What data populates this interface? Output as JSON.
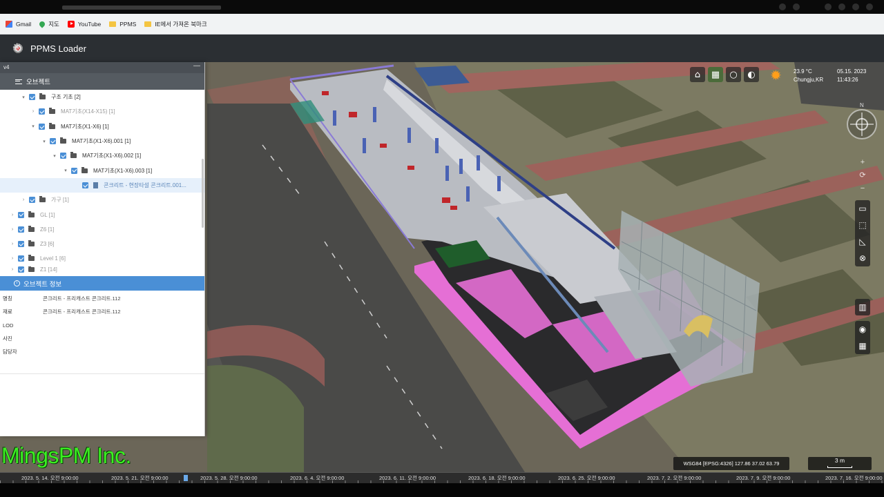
{
  "bookmarks": [
    {
      "label": "Gmail",
      "icon": "gmail-icon"
    },
    {
      "label": "지도",
      "icon": "maps-icon"
    },
    {
      "label": "YouTube",
      "icon": "youtube-icon"
    },
    {
      "label": "PPMS",
      "icon": "folder-icon"
    },
    {
      "label": "IE에서 가져온 북마크",
      "icon": "folder-icon"
    }
  ],
  "app": {
    "title": "PPMS Loader"
  },
  "panel": {
    "version": "v4",
    "tree_title": "오브젝트",
    "tree": [
      {
        "label": "구조 기초 [2]",
        "expander": "▾"
      },
      {
        "label": "MAT기초(X14-X15) [1]",
        "expander": "›"
      },
      {
        "label": "MAT기초(X1-X6) [1]",
        "expander": "▾"
      },
      {
        "label": "MAT기초(X1-X6).001 [1]",
        "expander": "▾"
      },
      {
        "label": "MAT기초(X1-X6).002 [1]",
        "expander": "▾"
      },
      {
        "label": "MAT기초(X1-X6).003 [1]",
        "expander": "▾"
      },
      {
        "label": "콘크리트 - 현장타설 콘크리트.001...",
        "expander": ""
      },
      {
        "label": "가구 [1]",
        "expander": "›"
      },
      {
        "label": "GL [1]",
        "expander": "›"
      },
      {
        "label": "Z6 [1]",
        "expander": "›"
      },
      {
        "label": "Z3 [6]",
        "expander": "›"
      },
      {
        "label": "Level 1 [6]",
        "expander": "›"
      },
      {
        "label": "Z1 [14]",
        "expander": "›"
      }
    ],
    "info_title": "오브젝트 정보",
    "info": [
      {
        "key": "명칭",
        "value": "콘크리트 - 프리캐스트 콘크리트.112"
      },
      {
        "key": "재료",
        "value": "콘크리트 - 프리캐스트 콘크리트.112"
      },
      {
        "key": "LOD",
        "value": ""
      },
      {
        "key": "사진",
        "value": ""
      },
      {
        "key": "담당자",
        "value": ""
      }
    ]
  },
  "weather": {
    "temp": "23.9 °C",
    "location": "Chungju,KR",
    "date": "05.15. 2023",
    "time": "11:43:26"
  },
  "compass": {
    "north": "N"
  },
  "zoom": {
    "in": "+",
    "reset": "⟳",
    "out": "−"
  },
  "status": {
    "coords": "WSG84 [EPSG:4326] 127.86 37.02 63.79",
    "scale": "3 m"
  },
  "watermark": "MingsPM Inc.",
  "timeline": [
    "2023. 5. 14. 오전 9:00:00",
    "2023. 5. 21. 오전 9:00:00",
    "2023. 5. 28. 오전 9:00:00",
    "2023. 6. 4. 오전 9:00:00",
    "2023. 6. 11. 오전 9:00:00",
    "2023. 6. 18. 오전 9:00:00",
    "2023. 6. 25. 오전 9:00:00",
    "2023. 7. 2. 오전 9:00:00",
    "2023. 7. 9. 오전 9:00:00",
    "2023. 7. 16. 오전 9:00:00"
  ],
  "colors": {
    "accent": "#4a8fd6",
    "header": "#2b2f33",
    "watermark": "#3cf022",
    "model_pink": "#e86bd6"
  }
}
